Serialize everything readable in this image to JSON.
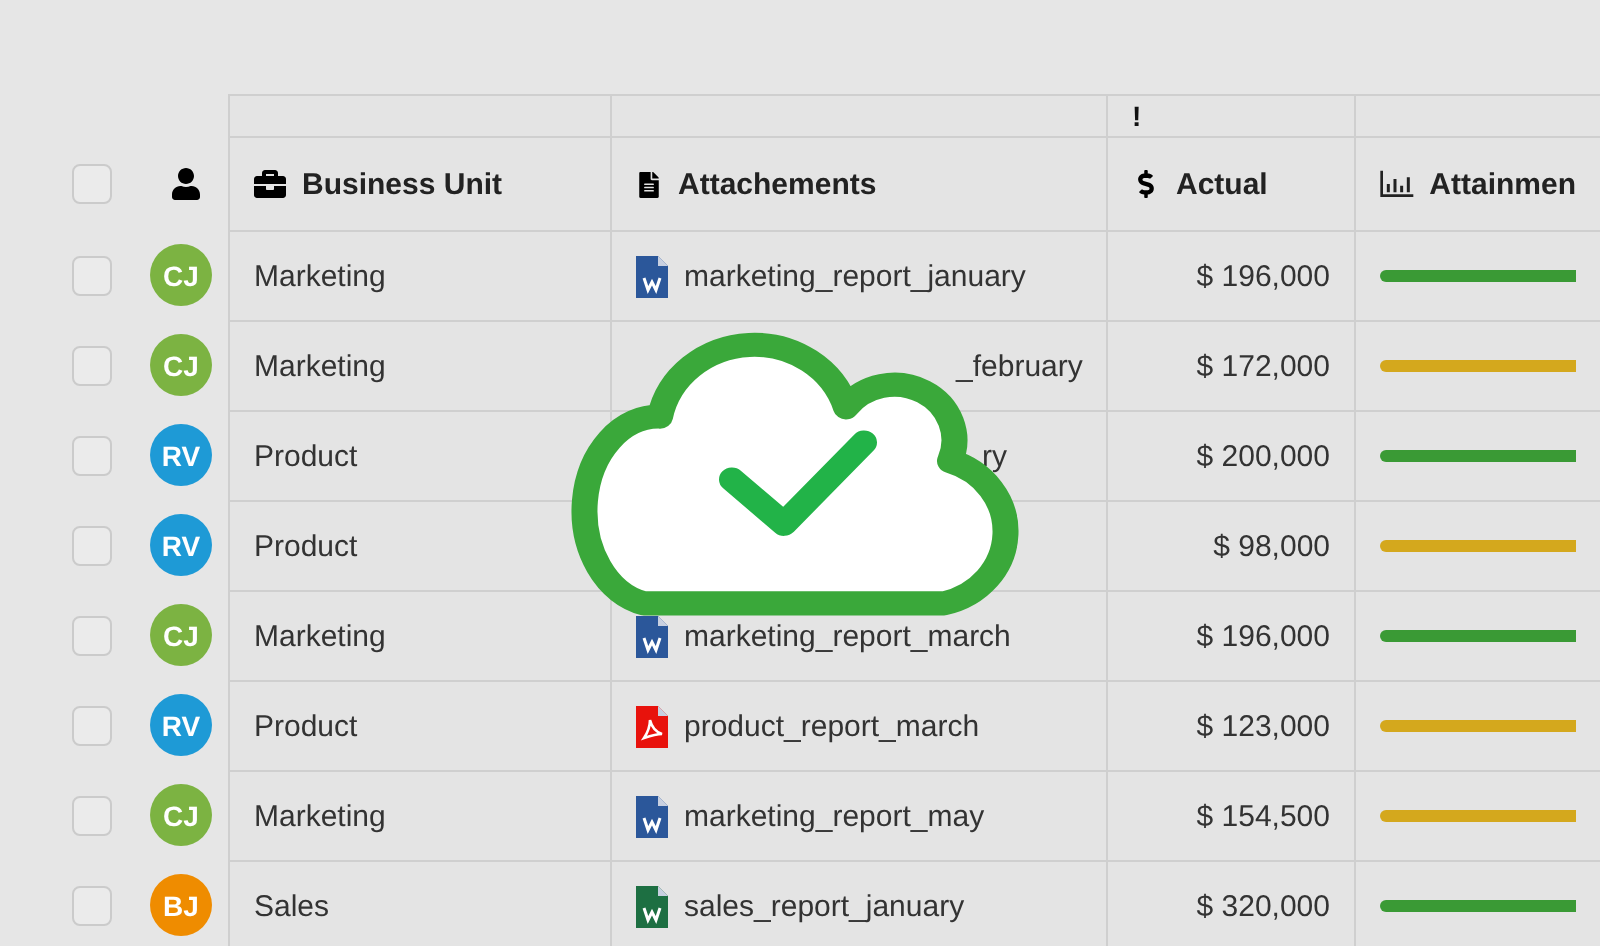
{
  "select_all": {
    "checked": false
  },
  "group_header": {
    "mark": "!"
  },
  "columns": [
    {
      "kind": "unit",
      "label": "Business Unit"
    },
    {
      "kind": "file",
      "label": "Attachements"
    },
    {
      "kind": "money",
      "label": "Actual"
    },
    {
      "kind": "chart",
      "label": "Attainmen"
    }
  ],
  "rows": [
    {
      "checked": false,
      "avatar": {
        "initials": "CJ",
        "color": "#7cb342"
      },
      "unit": "Marketing",
      "attachment": {
        "kind": "word",
        "name": "marketing_report_january"
      },
      "actual": "$ 196,000",
      "color": "#3a9a35"
    },
    {
      "checked": false,
      "avatar": {
        "initials": "CJ",
        "color": "#7cb342"
      },
      "unit": "Marketing",
      "attachment": {
        "kind": "tail",
        "name": "_february"
      },
      "actual": "$ 172,000",
      "color": "#d4a81d"
    },
    {
      "checked": false,
      "avatar": {
        "initials": "RV",
        "color": "#1e9ad6"
      },
      "unit": "Product",
      "attachment": {
        "kind": "tail",
        "name": "ry"
      },
      "actual": "$ 200,000",
      "color": "#3a9a35"
    },
    {
      "checked": false,
      "avatar": {
        "initials": "RV",
        "color": "#1e9ad6"
      },
      "unit": "Product",
      "attachment": {
        "kind": "hidden"
      },
      "actual": "$ 98,000",
      "color": "#d4a81d"
    },
    {
      "checked": false,
      "avatar": {
        "initials": "CJ",
        "color": "#7cb342"
      },
      "unit": "Marketing",
      "attachment": {
        "kind": "word",
        "name": "marketing_report_march"
      },
      "actual": "$ 196,000",
      "color": "#3a9a35"
    },
    {
      "checked": false,
      "avatar": {
        "initials": "RV",
        "color": "#1e9ad6"
      },
      "unit": "Product",
      "attachment": {
        "kind": "pdf",
        "name": "product_report_march"
      },
      "actual": "$ 123,000",
      "color": "#d4a81d"
    },
    {
      "checked": false,
      "avatar": {
        "initials": "CJ",
        "color": "#7cb342"
      },
      "unit": "Marketing",
      "attachment": {
        "kind": "word",
        "name": "marketing_report_may"
      },
      "actual": "$ 154,500",
      "color": "#d4a81d"
    },
    {
      "checked": false,
      "avatar": {
        "initials": "BJ",
        "color": "#ef8c00"
      },
      "unit": "Sales",
      "attachment": {
        "kind": "excel",
        "name": "sales_report_january"
      },
      "actual": "$ 320,000",
      "color": "#3a9a35"
    }
  ]
}
